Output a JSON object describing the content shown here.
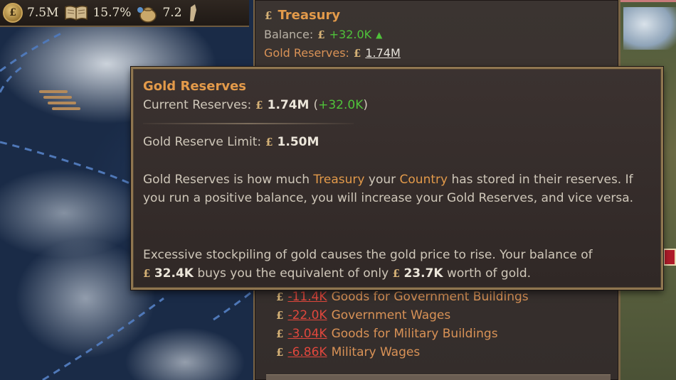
{
  "topbar": {
    "items": [
      {
        "icon": "pound-coin-icon",
        "glyph": "£",
        "value": "7.5M"
      },
      {
        "icon": "book-icon",
        "value": "15.7%"
      },
      {
        "icon": "money-bag-icon",
        "value": "7.2"
      }
    ]
  },
  "treasury": {
    "currency_glyph": "£",
    "title": "Treasury",
    "balance_label": "Balance:",
    "balance_value": "+32.0K",
    "reserves_label": "Gold Reserves:",
    "reserves_value": "1.74M",
    "expenses": [
      {
        "value": "-11.4K",
        "label": "Goods for Government Buildings"
      },
      {
        "value": "-22.0K",
        "label": "Government Wages"
      },
      {
        "value": "-3.04K",
        "label": "Goods for Military Buildings"
      },
      {
        "value": "-6.86K",
        "label": "Military Wages"
      }
    ]
  },
  "tooltip": {
    "title": "Gold Reserves",
    "current_label": "Current Reserves:",
    "current_value": "1.74M",
    "current_change_open": "(",
    "current_change": "+32.0K",
    "current_change_close": ")",
    "limit_label": "Gold Reserve Limit:",
    "limit_value": "1.50M",
    "para1": {
      "t1": "Gold Reserves is how much ",
      "link1": "Treasury",
      "t2": " your ",
      "link2": "Country",
      "t3": " has stored in their reserves. If you run a positive balance, you will increase your Gold Reserves, and vice versa."
    },
    "para2": {
      "t1": "Excessive stockpiling of gold causes the gold price to rise. Your balance of",
      "v1": "32.4K",
      "t2": "buys you the equivalent of only",
      "v2": "23.7K",
      "t3": "worth of gold."
    }
  },
  "colors": {
    "accent_orange": "#e39a4a",
    "positive_green": "#4fc23a",
    "negative_red": "#e0473d",
    "panel_bg": "#342d2b",
    "border_gold": "#8f7650"
  }
}
